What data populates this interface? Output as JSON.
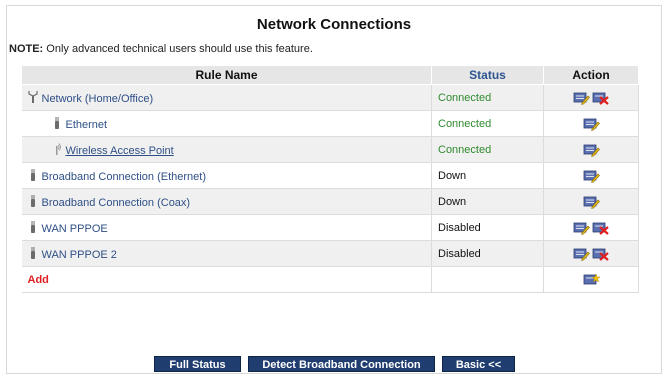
{
  "page": {
    "title": "Network Connections",
    "note_label": "NOTE:",
    "note_text": " Only advanced technical users should use this feature."
  },
  "table": {
    "headers": {
      "rule_name": "Rule Name",
      "status": "Status",
      "action": "Action"
    },
    "rows": [
      {
        "name": "Network (Home/Office)",
        "status": "Connected",
        "icon": "hub-icon",
        "actions": [
          "edit-icon",
          "delete-icon"
        ]
      },
      {
        "name": "Ethernet",
        "status": "Connected",
        "icon": "plug-icon",
        "actions": [
          "edit-icon"
        ]
      },
      {
        "name": "Wireless Access Point",
        "status": "Connected",
        "icon": "antenna-icon",
        "actions": [
          "edit-icon"
        ]
      },
      {
        "name": "Broadband Connection (Ethernet)",
        "status": "Down",
        "icon": "plug-icon",
        "actions": [
          "edit-icon"
        ]
      },
      {
        "name": "Broadband Connection (Coax)",
        "status": "Down",
        "icon": "plug-icon",
        "actions": [
          "edit-icon"
        ]
      },
      {
        "name": "WAN PPPOE",
        "status": "Disabled",
        "icon": "plug-icon",
        "actions": [
          "edit-icon",
          "delete-icon"
        ]
      },
      {
        "name": "WAN PPPOE 2",
        "status": "Disabled",
        "icon": "plug-icon",
        "actions": [
          "edit-icon",
          "delete-icon"
        ]
      }
    ],
    "add_label": "Add",
    "add_action_icon": "add-icon"
  },
  "buttons": {
    "full_status": "Full Status",
    "detect": "Detect Broadband Connection",
    "basic": "Basic <<"
  },
  "colors": {
    "connected": "#2f8a2f",
    "link": "#2e4f86",
    "add": "#e02020",
    "button_bg": "#1f3d6e"
  }
}
